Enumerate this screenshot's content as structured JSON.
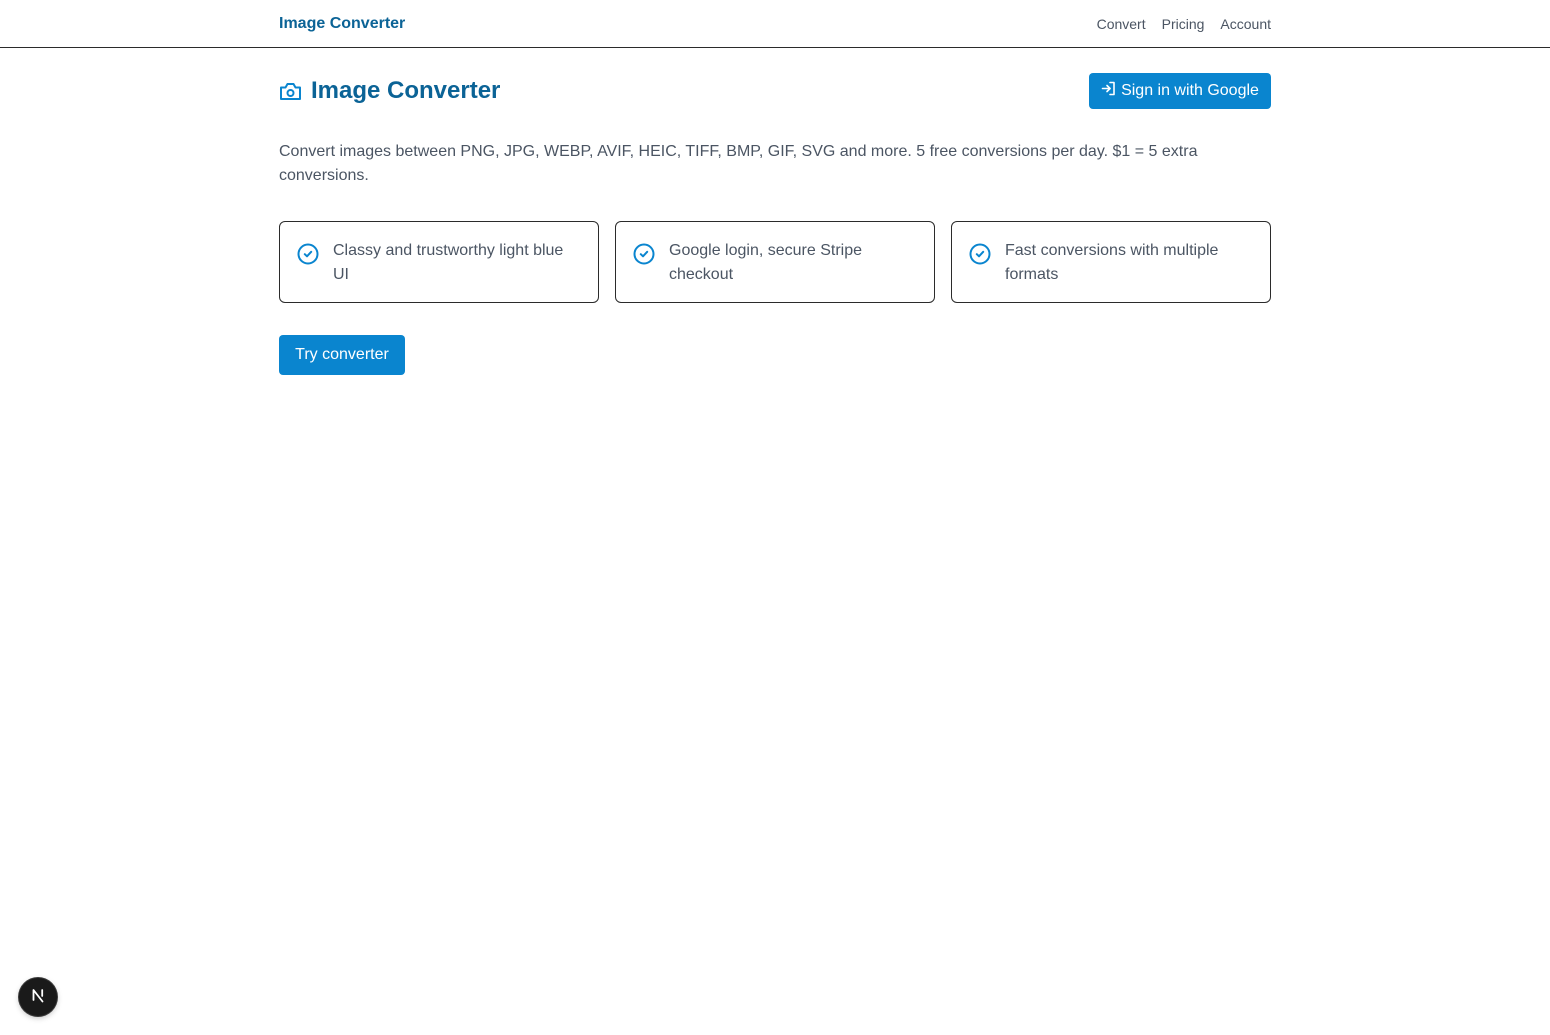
{
  "topbar": {
    "brand": "Image Converter",
    "nav": [
      {
        "label": "Convert"
      },
      {
        "label": "Pricing"
      },
      {
        "label": "Account"
      }
    ]
  },
  "header": {
    "title": "Image Converter",
    "title_icon": "camera-icon",
    "signin_label": "Sign in with Google",
    "signin_icon": "sign-in-icon"
  },
  "description": "Convert images between PNG, JPG, WEBP, AVIF, HEIC, TIFF, BMP, GIF, SVG and more. 5 free conversions per day. $1 = 5 extra conversions.",
  "features": [
    {
      "icon": "check-circle-icon",
      "text": "Classy and trustworthy light blue UI"
    },
    {
      "icon": "check-circle-icon",
      "text": "Google login, secure Stripe checkout"
    },
    {
      "icon": "check-circle-icon",
      "text": "Fast conversions with multiple formats"
    }
  ],
  "cta": {
    "label": "Try converter"
  },
  "dev_badge": {
    "letter": "N",
    "icon": "nextjs-logo-icon"
  },
  "colors": {
    "brand": "#0b6396",
    "button": "#0a85cf",
    "text_muted": "#4b5563",
    "border": "#2b2b2b"
  }
}
